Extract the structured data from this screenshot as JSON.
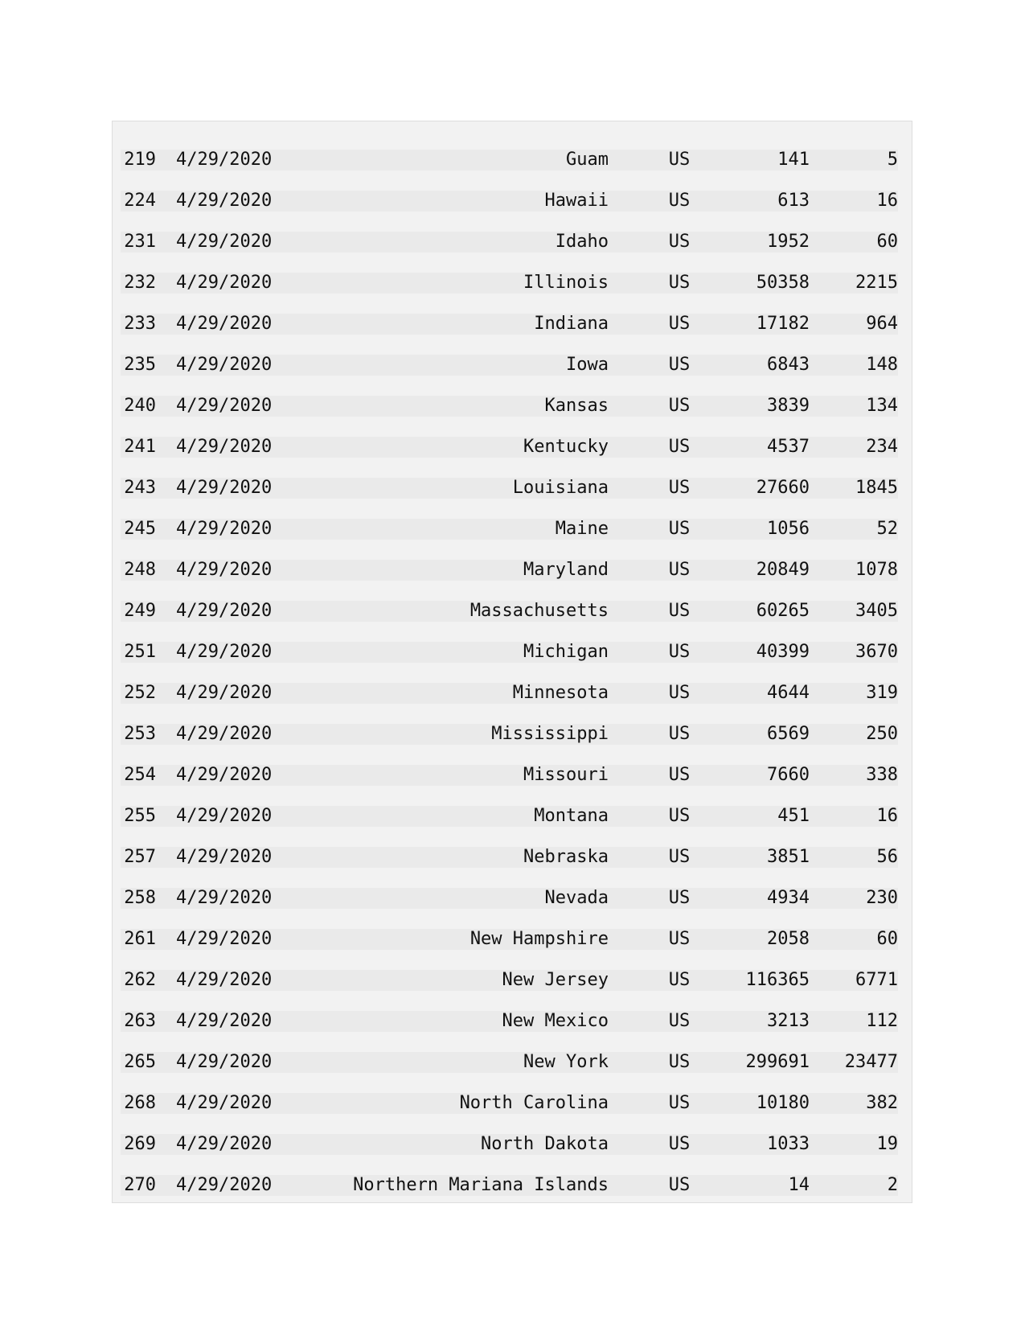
{
  "table": {
    "rows": [
      {
        "idx": "219",
        "date": "4/29/2020",
        "state": "Guam",
        "country": "US",
        "confirmed": "141",
        "deaths": "5"
      },
      {
        "idx": "224",
        "date": "4/29/2020",
        "state": "Hawaii",
        "country": "US",
        "confirmed": "613",
        "deaths": "16"
      },
      {
        "idx": "231",
        "date": "4/29/2020",
        "state": "Idaho",
        "country": "US",
        "confirmed": "1952",
        "deaths": "60"
      },
      {
        "idx": "232",
        "date": "4/29/2020",
        "state": "Illinois",
        "country": "US",
        "confirmed": "50358",
        "deaths": "2215"
      },
      {
        "idx": "233",
        "date": "4/29/2020",
        "state": "Indiana",
        "country": "US",
        "confirmed": "17182",
        "deaths": "964"
      },
      {
        "idx": "235",
        "date": "4/29/2020",
        "state": "Iowa",
        "country": "US",
        "confirmed": "6843",
        "deaths": "148"
      },
      {
        "idx": "240",
        "date": "4/29/2020",
        "state": "Kansas",
        "country": "US",
        "confirmed": "3839",
        "deaths": "134"
      },
      {
        "idx": "241",
        "date": "4/29/2020",
        "state": "Kentucky",
        "country": "US",
        "confirmed": "4537",
        "deaths": "234"
      },
      {
        "idx": "243",
        "date": "4/29/2020",
        "state": "Louisiana",
        "country": "US",
        "confirmed": "27660",
        "deaths": "1845"
      },
      {
        "idx": "245",
        "date": "4/29/2020",
        "state": "Maine",
        "country": "US",
        "confirmed": "1056",
        "deaths": "52"
      },
      {
        "idx": "248",
        "date": "4/29/2020",
        "state": "Maryland",
        "country": "US",
        "confirmed": "20849",
        "deaths": "1078"
      },
      {
        "idx": "249",
        "date": "4/29/2020",
        "state": "Massachusetts",
        "country": "US",
        "confirmed": "60265",
        "deaths": "3405"
      },
      {
        "idx": "251",
        "date": "4/29/2020",
        "state": "Michigan",
        "country": "US",
        "confirmed": "40399",
        "deaths": "3670"
      },
      {
        "idx": "252",
        "date": "4/29/2020",
        "state": "Minnesota",
        "country": "US",
        "confirmed": "4644",
        "deaths": "319"
      },
      {
        "idx": "253",
        "date": "4/29/2020",
        "state": "Mississippi",
        "country": "US",
        "confirmed": "6569",
        "deaths": "250"
      },
      {
        "idx": "254",
        "date": "4/29/2020",
        "state": "Missouri",
        "country": "US",
        "confirmed": "7660",
        "deaths": "338"
      },
      {
        "idx": "255",
        "date": "4/29/2020",
        "state": "Montana",
        "country": "US",
        "confirmed": "451",
        "deaths": "16"
      },
      {
        "idx": "257",
        "date": "4/29/2020",
        "state": "Nebraska",
        "country": "US",
        "confirmed": "3851",
        "deaths": "56"
      },
      {
        "idx": "258",
        "date": "4/29/2020",
        "state": "Nevada",
        "country": "US",
        "confirmed": "4934",
        "deaths": "230"
      },
      {
        "idx": "261",
        "date": "4/29/2020",
        "state": "New Hampshire",
        "country": "US",
        "confirmed": "2058",
        "deaths": "60"
      },
      {
        "idx": "262",
        "date": "4/29/2020",
        "state": "New Jersey",
        "country": "US",
        "confirmed": "116365",
        "deaths": "6771"
      },
      {
        "idx": "263",
        "date": "4/29/2020",
        "state": "New Mexico",
        "country": "US",
        "confirmed": "3213",
        "deaths": "112"
      },
      {
        "idx": "265",
        "date": "4/29/2020",
        "state": "New York",
        "country": "US",
        "confirmed": "299691",
        "deaths": "23477"
      },
      {
        "idx": "268",
        "date": "4/29/2020",
        "state": "North Carolina",
        "country": "US",
        "confirmed": "10180",
        "deaths": "382"
      },
      {
        "idx": "269",
        "date": "4/29/2020",
        "state": "North Dakota",
        "country": "US",
        "confirmed": "1033",
        "deaths": "19"
      },
      {
        "idx": "270",
        "date": "4/29/2020",
        "state": "Northern Mariana Islands",
        "country": "US",
        "confirmed": "14",
        "deaths": "2"
      }
    ]
  }
}
